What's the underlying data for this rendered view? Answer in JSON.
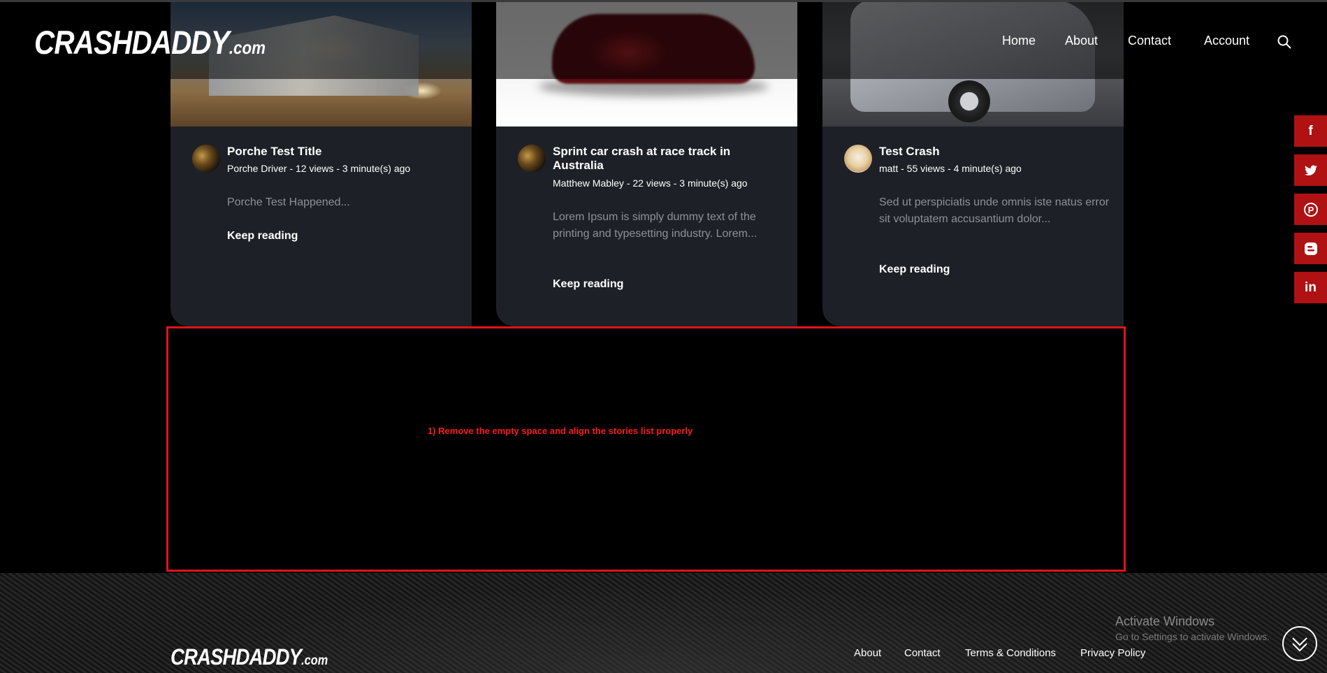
{
  "header": {
    "logo_main": "CRASHDADDY",
    "logo_suffix": ".com",
    "nav": [
      "Home",
      "About",
      "Contact",
      "Account"
    ],
    "search_icon": "search-icon"
  },
  "stories": [
    {
      "title": "Porche Test Title",
      "meta": "Porche Driver - 12 views - 3 minute(s) ago",
      "excerpt": "Porche Test Happened...",
      "more": "Keep reading"
    },
    {
      "title": "Sprint car crash at race track in Australia",
      "meta": "Matthew Mabley - 22 views - 3 minute(s) ago",
      "excerpt": "Lorem Ipsum is simply dummy text of the printing and typesetting industry. Lorem...",
      "more": "Keep reading"
    },
    {
      "title": "Test Crash",
      "meta": "matt - 55 views - 4 minute(s) ago",
      "excerpt": "Sed ut perspiciatis unde omnis iste natus error sit voluptatem accusantium dolor...",
      "more": "Keep reading"
    }
  ],
  "social": [
    {
      "icon": "facebook-icon",
      "glyph": "f"
    },
    {
      "icon": "twitter-icon",
      "glyph": "🐦"
    },
    {
      "icon": "pinterest-icon",
      "glyph": "P"
    },
    {
      "icon": "blogger-icon",
      "glyph": "B"
    },
    {
      "icon": "linkedin-icon",
      "glyph": "in"
    }
  ],
  "annotation": {
    "text": "1) Remove the empty space and align the stories list properly",
    "color": "#e0141a"
  },
  "footer": {
    "logo_main": "CRASHDADDY",
    "logo_suffix": ".com",
    "links": [
      "About",
      "Contact",
      "Terms & Conditions",
      "Privacy Policy"
    ]
  },
  "windows_watermark": {
    "title": "Activate Windows",
    "subtitle": "Go to Settings to activate Windows."
  },
  "colors": {
    "card_bg": "#1d2127",
    "social_bg": "#b01112",
    "excerpt": "#8d9298"
  }
}
